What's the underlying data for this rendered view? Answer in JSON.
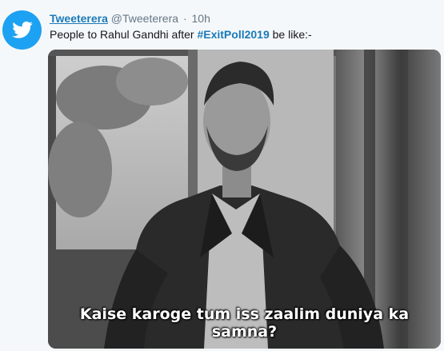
{
  "tweet": {
    "display_name": "Tweeterera",
    "handle": "@Tweeterera",
    "separator": "·",
    "time": "10h",
    "text_before": "People to Rahul Gandhi after ",
    "hashtag": "#ExitPoll2019",
    "text_after": " be like:-"
  },
  "media": {
    "subtitle": "Kaise karoge tum iss zaalim duniya ka samna?"
  },
  "colors": {
    "avatar_bg": "#1da1f2",
    "link": "#1b7ab8"
  }
}
